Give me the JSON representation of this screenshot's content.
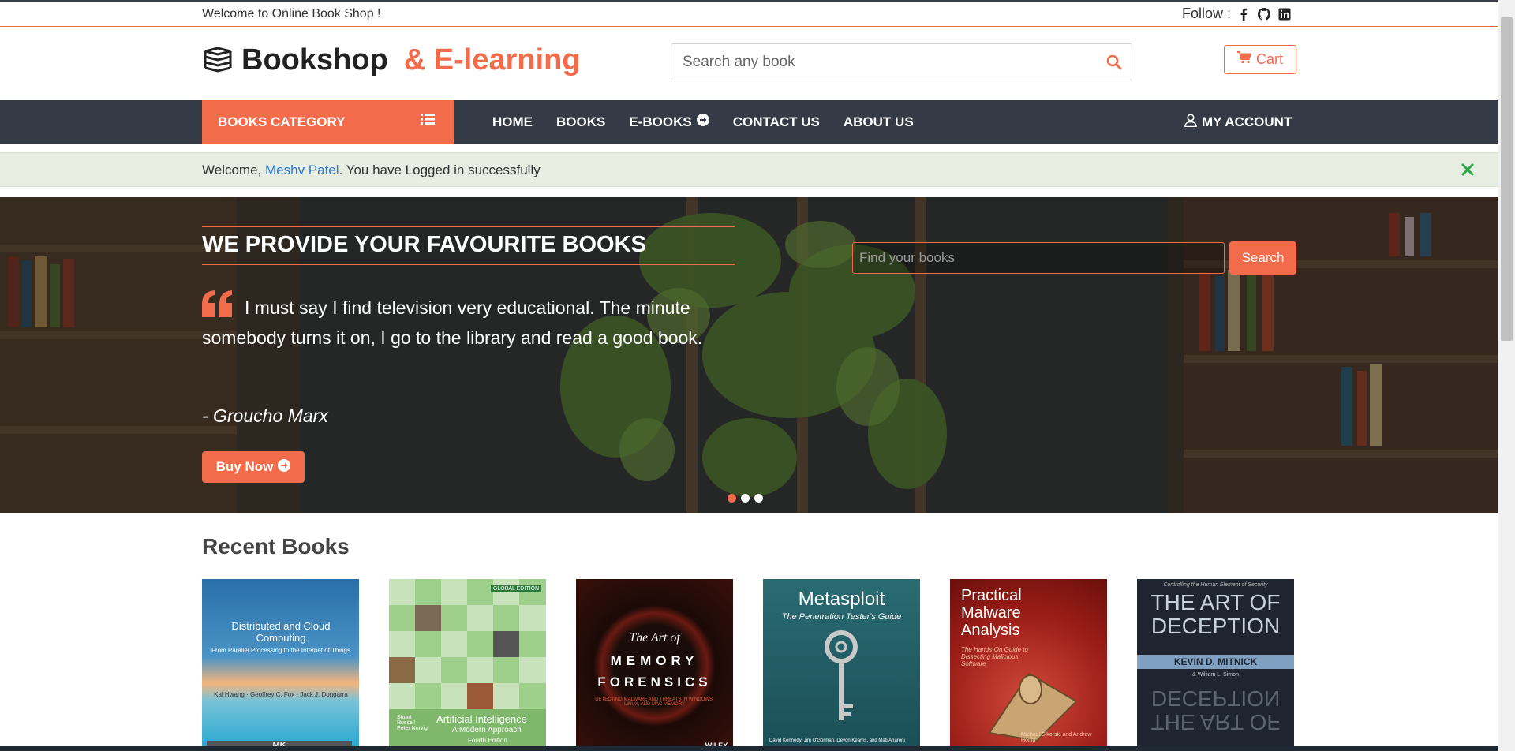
{
  "topbar": {
    "welcome": "Welcome to Online Book Shop !",
    "follow_label": "Follow :",
    "social_icons": [
      "facebook-icon",
      "github-icon",
      "linkedin-icon"
    ]
  },
  "header": {
    "brand_part1": "Bookshop",
    "brand_part2": "& E-learning",
    "search_placeholder": "Search any book",
    "cart_label": "Cart"
  },
  "nav": {
    "category_label": "BOOKS CATEGORY",
    "items": [
      "HOME",
      "BOOKS",
      "E-BOOKS",
      "CONTACT US",
      "ABOUT US"
    ],
    "account_label": "MY ACCOUNT"
  },
  "alert": {
    "prefix": "Welcome,",
    "user": "Meshv Patel",
    "suffix": ". You have Logged in successfully"
  },
  "hero": {
    "title": "WE PROVIDE YOUR FAVOURITE BOOKS",
    "quote": "I must say I find television very educational. The minute somebody turns it on, I go to the library and read a good book.",
    "author": "- Groucho Marx",
    "buy_label": "Buy Now",
    "find_placeholder": "Find your books",
    "find_button": "Search",
    "slides": 3,
    "active_slide": 1
  },
  "recent": {
    "title": "Recent Books",
    "books": [
      {
        "title": "Distributed and Cloud Computing",
        "subtitle": "From Parallel Processing to the Internet of Things",
        "authors": "Kai Hwang · Geoffrey C. Fox · Jack J. Dongarra",
        "publisher": "MK"
      },
      {
        "title": "Artificial Intelligence",
        "subtitle": "A Modern Approach",
        "edition": "Fourth Edition",
        "badge": "GLOBAL EDITION",
        "authors": "Stuart Russell · Peter Norvig"
      },
      {
        "title_line1": "The Art of",
        "title_line2": "MEMORY",
        "title_line3": "FORENSICS",
        "tagline": "DETECTING MALWARE AND THREATS IN WINDOWS, LINUX, AND MAC MEMORY",
        "publisher": "WILEY"
      },
      {
        "title": "Metasploit",
        "subtitle": "The Penetration Tester's Guide",
        "authors": "David Kennedy, Jim O'Gorman, Devon Kearns, and Mati Aharoni"
      },
      {
        "title_line1": "Practical",
        "title_line2": "Malware",
        "title_line3": "Analysis",
        "subtitle": "The Hands-On Guide to Dissecting Malicious Software",
        "authors": "Michael Sikorski and Andrew Honig"
      },
      {
        "tagline": "Controlling the Human Element of Security",
        "title_line1": "THE ART OF",
        "title_line2": "DECEPTION",
        "author": "KEVIN D. MITNICK",
        "coauthor": "& William L. Simon"
      }
    ]
  },
  "colors": {
    "accent": "#f26b4b",
    "nav_bg": "#343a46",
    "alert_bg": "#e8ede2",
    "link": "#2b7bd6"
  }
}
